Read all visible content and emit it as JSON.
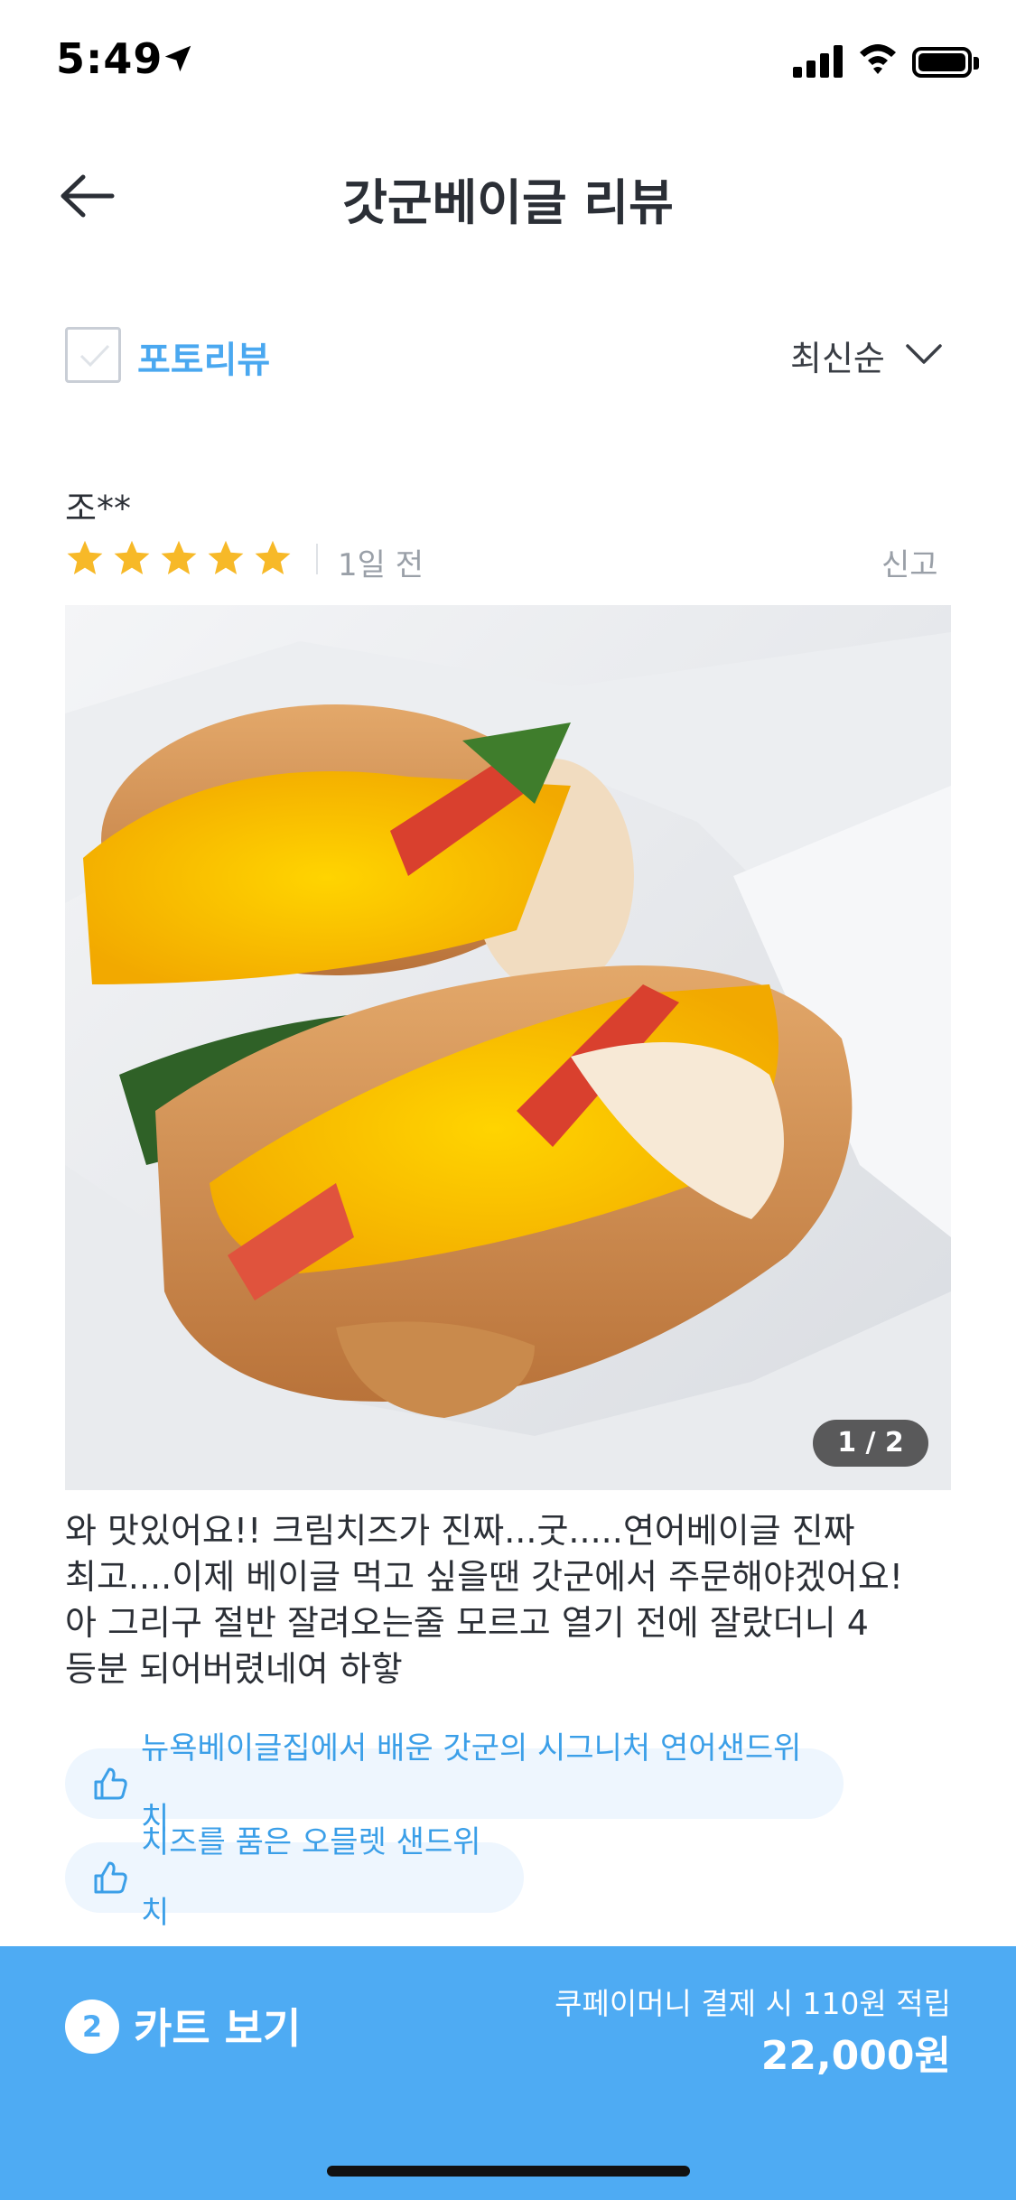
{
  "status_bar": {
    "time": "5:49"
  },
  "header": {
    "title": "갓군베이글 리뷰"
  },
  "filter": {
    "photo_review_label": "포토리뷰",
    "photo_review_checked": false,
    "sort_label": "최신순"
  },
  "review": {
    "author": "조**",
    "rating": 5,
    "date": "1일 전",
    "report_label": "신고",
    "photo_pager": "1 / 2",
    "text": "와 맛있어요!! 크림치즈가 진짜...굿.....연어베이글 진짜\n최고....이제 베이글 먹고 싶을땐 갓군에서 주문해야겠어요!\n아 그리구 절반 잘려오는줄 모르고 열기 전에 잘랐더니 4\n등분 되어버렸네여 하핳",
    "liked_items": [
      "뉴욕베이글집에서 배운 갓군의 시그니처 연어샌드위치",
      "치즈를 품은 오믈렛 샌드위치"
    ]
  },
  "cart": {
    "count": "2",
    "label": "카트 보기",
    "reward_text": "쿠페이머니 결제 시 110원 적립",
    "total": "22,000원"
  },
  "colors": {
    "accent": "#4eabf3",
    "tag_bg": "#eef6fe",
    "star": "#f7b928"
  }
}
